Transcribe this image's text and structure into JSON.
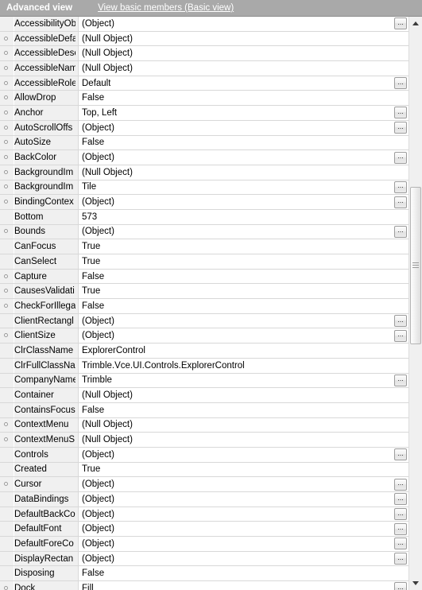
{
  "header": {
    "title": "Advanced view",
    "link_label": "View basic members (Basic view)"
  },
  "scrollbar": {
    "up_icon": "scroll-up-arrow-icon",
    "down_icon": "scroll-down-arrow-icon"
  },
  "grid": {
    "ellipsis_label": "...",
    "rows": [
      {
        "name": "AccessibilityOb",
        "value": "(Object)",
        "bullet": false,
        "ellipsis": true
      },
      {
        "name": "AccessibleDefa",
        "value": "(Null Object)",
        "bullet": true,
        "ellipsis": false
      },
      {
        "name": "AccessibleDesc",
        "value": "(Null Object)",
        "bullet": true,
        "ellipsis": false
      },
      {
        "name": "AccessibleNam",
        "value": "(Null Object)",
        "bullet": true,
        "ellipsis": false
      },
      {
        "name": "AccessibleRole",
        "value": "Default",
        "bullet": true,
        "ellipsis": true
      },
      {
        "name": "AllowDrop",
        "value": "False",
        "bullet": true,
        "ellipsis": false
      },
      {
        "name": "Anchor",
        "value": "Top, Left",
        "bullet": true,
        "ellipsis": true
      },
      {
        "name": "AutoScrollOffs",
        "value": "(Object)",
        "bullet": true,
        "ellipsis": true
      },
      {
        "name": "AutoSize",
        "value": "False",
        "bullet": true,
        "ellipsis": false
      },
      {
        "name": "BackColor",
        "value": "(Object)",
        "bullet": true,
        "ellipsis": true
      },
      {
        "name": "BackgroundIm",
        "value": "(Null Object)",
        "bullet": true,
        "ellipsis": false
      },
      {
        "name": "BackgroundIm",
        "value": "Tile",
        "bullet": true,
        "ellipsis": true
      },
      {
        "name": "BindingContex",
        "value": "(Object)",
        "bullet": true,
        "ellipsis": true
      },
      {
        "name": "Bottom",
        "value": "573",
        "bullet": false,
        "ellipsis": false
      },
      {
        "name": "Bounds",
        "value": "(Object)",
        "bullet": true,
        "ellipsis": true
      },
      {
        "name": "CanFocus",
        "value": "True",
        "bullet": false,
        "ellipsis": false
      },
      {
        "name": "CanSelect",
        "value": "True",
        "bullet": false,
        "ellipsis": false
      },
      {
        "name": "Capture",
        "value": "False",
        "bullet": true,
        "ellipsis": false
      },
      {
        "name": "CausesValidati",
        "value": "True",
        "bullet": true,
        "ellipsis": false
      },
      {
        "name": "CheckForIllega",
        "value": "False",
        "bullet": true,
        "ellipsis": false
      },
      {
        "name": "ClientRectangl",
        "value": "(Object)",
        "bullet": false,
        "ellipsis": true
      },
      {
        "name": "ClientSize",
        "value": "(Object)",
        "bullet": true,
        "ellipsis": true
      },
      {
        "name": "ClrClassName",
        "value": "ExplorerControl",
        "bullet": false,
        "ellipsis": false
      },
      {
        "name": "ClrFullClassNa",
        "value": "Trimble.Vce.UI.Controls.ExplorerControl",
        "bullet": false,
        "ellipsis": false
      },
      {
        "name": "CompanyName",
        "value": "Trimble",
        "bullet": false,
        "ellipsis": true
      },
      {
        "name": "Container",
        "value": "(Null Object)",
        "bullet": false,
        "ellipsis": false
      },
      {
        "name": "ContainsFocus",
        "value": "False",
        "bullet": false,
        "ellipsis": false
      },
      {
        "name": "ContextMenu",
        "value": "(Null Object)",
        "bullet": true,
        "ellipsis": false
      },
      {
        "name": "ContextMenuS",
        "value": "(Null Object)",
        "bullet": true,
        "ellipsis": false
      },
      {
        "name": "Controls",
        "value": "(Object)",
        "bullet": false,
        "ellipsis": true
      },
      {
        "name": "Created",
        "value": "True",
        "bullet": false,
        "ellipsis": false
      },
      {
        "name": "Cursor",
        "value": "(Object)",
        "bullet": true,
        "ellipsis": true
      },
      {
        "name": "DataBindings",
        "value": "(Object)",
        "bullet": false,
        "ellipsis": true
      },
      {
        "name": "DefaultBackCo",
        "value": "(Object)",
        "bullet": false,
        "ellipsis": true
      },
      {
        "name": "DefaultFont",
        "value": "(Object)",
        "bullet": false,
        "ellipsis": true
      },
      {
        "name": "DefaultForeCo",
        "value": "(Object)",
        "bullet": false,
        "ellipsis": true
      },
      {
        "name": "DisplayRectan",
        "value": "(Object)",
        "bullet": false,
        "ellipsis": true
      },
      {
        "name": "Disposing",
        "value": "False",
        "bullet": false,
        "ellipsis": false
      },
      {
        "name": "Dock",
        "value": "Fill",
        "bullet": true,
        "ellipsis": true
      }
    ]
  }
}
